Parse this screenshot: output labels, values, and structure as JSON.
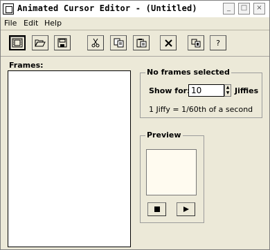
{
  "window": {
    "title": "Animated Cursor Editor - (Untitled)",
    "controls": {
      "minimize": "_",
      "maximize": "□",
      "close": "×"
    }
  },
  "menubar": [
    {
      "label": "File"
    },
    {
      "label": "Edit"
    },
    {
      "label": "Help"
    }
  ],
  "toolbar": {
    "icons": [
      "new-frames-icon",
      "open-folder-icon",
      "save-icon",
      "cut-icon",
      "copy-icon",
      "paste-icon",
      "delete-icon",
      "edit-frame-icon",
      "help-icon"
    ],
    "help_label": "?"
  },
  "frames": {
    "label": "Frames:",
    "items": []
  },
  "frame_settings": {
    "group_title": "No frames selected",
    "show_for_label": "Show for:",
    "show_for_value": "10",
    "unit_label": "Jiffies",
    "note": "1 Jiffy = 1/60th of a second"
  },
  "preview": {
    "title": "Preview",
    "stop_icon": "stop-icon",
    "play_icon": "play-icon"
  },
  "colors": {
    "preview_bg": "#fffbf0",
    "window_bg": "#ece9d8"
  }
}
